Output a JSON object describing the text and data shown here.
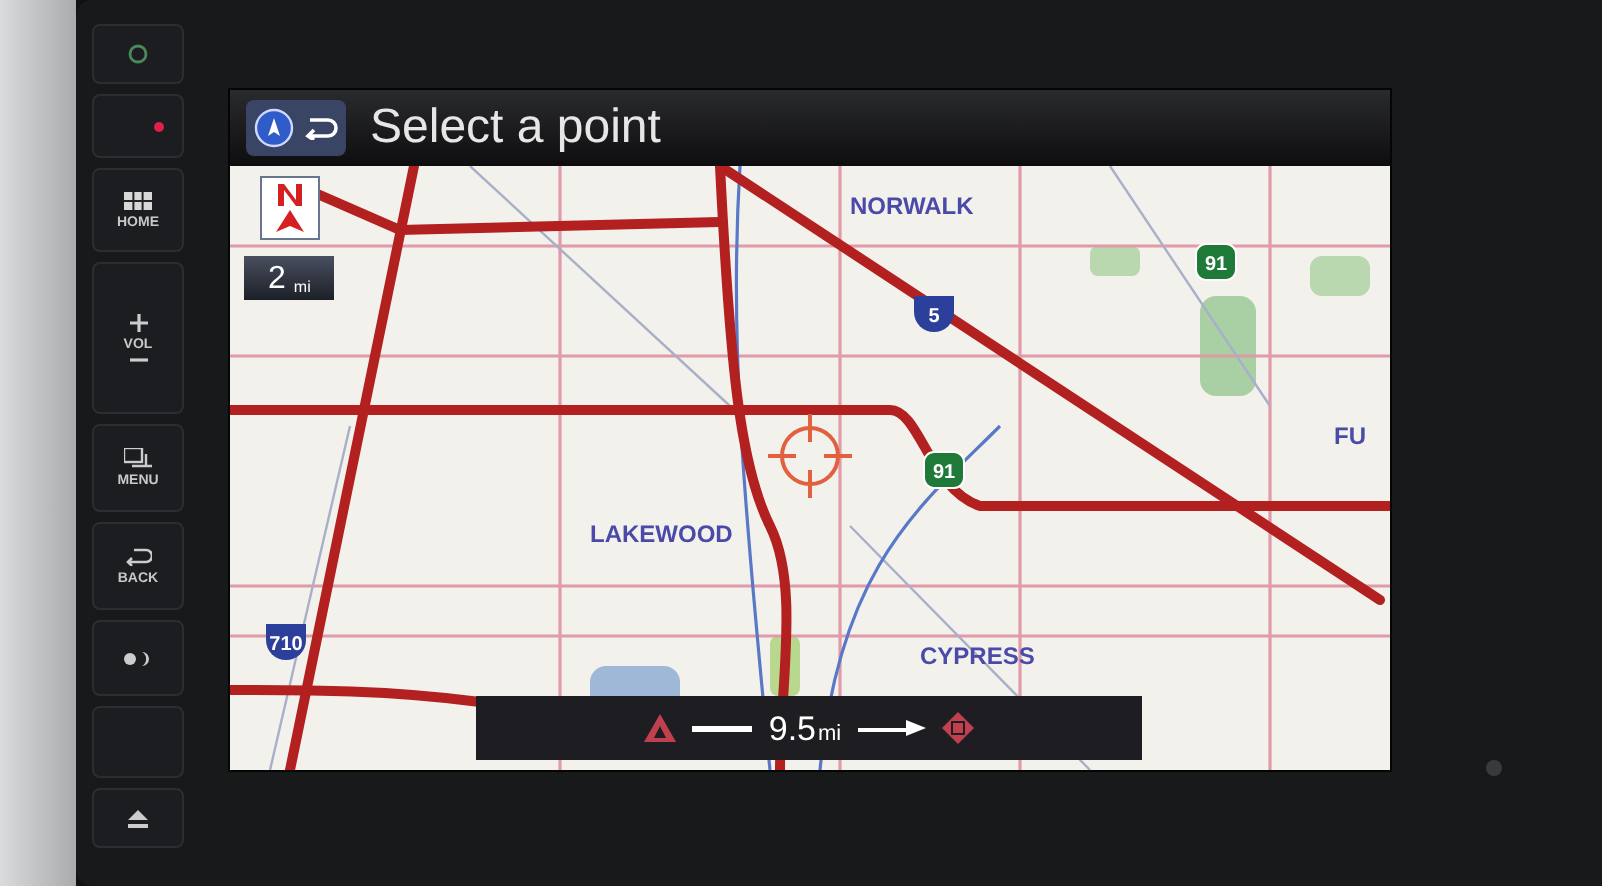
{
  "side_buttons": [
    {
      "kind": "power"
    },
    {
      "kind": "indicator"
    },
    {
      "kind": "home",
      "label": "HOME"
    },
    {
      "kind": "volume",
      "label": "VOL"
    },
    {
      "kind": "menu",
      "label": "MENU"
    },
    {
      "kind": "back",
      "label": "BACK"
    },
    {
      "kind": "day_night"
    },
    {
      "kind": "blank"
    },
    {
      "kind": "eject"
    }
  ],
  "header": {
    "title": "Select a point"
  },
  "map": {
    "scale": "2",
    "scale_unit": "mi",
    "places": [
      {
        "name": "NORWALK"
      },
      {
        "name": "LAKEWOOD"
      },
      {
        "name": "CYPRESS"
      },
      {
        "name": "FU"
      }
    ],
    "shields": [
      {
        "number": "5",
        "kind": "interstate"
      },
      {
        "number": "91",
        "kind": "state"
      },
      {
        "number": "91",
        "kind": "state"
      },
      {
        "number": "710",
        "kind": "interstate"
      }
    ]
  },
  "route_bar": {
    "distance": "9.5",
    "unit": "mi"
  }
}
